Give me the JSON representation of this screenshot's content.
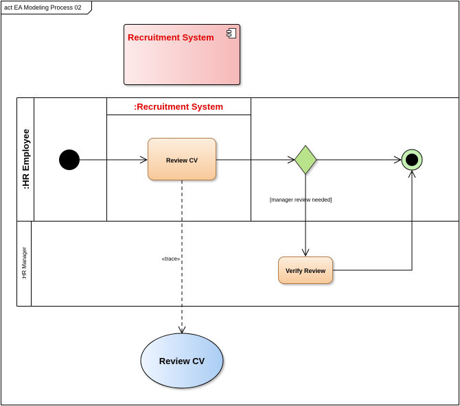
{
  "frame": {
    "title": "act EA Modeling Process 02"
  },
  "component": {
    "label": "Recruitment System",
    "icon": "component-icon"
  },
  "partition": {
    "label": ":Recruitment System"
  },
  "lanes": [
    {
      "label": ":HR Employee"
    },
    {
      "label": ":HR Manager"
    }
  ],
  "actions": {
    "review_cv": "Review CV",
    "verify_review": "Verify Review"
  },
  "guard": {
    "label": "[manager review needed]"
  },
  "trace": {
    "label": "«trace»"
  },
  "use_case": {
    "label": "Review CV"
  },
  "colors": {
    "action_fill_top": "#fdeedd",
    "action_fill_bottom": "#f8c99a",
    "action_border": "#b07a4a",
    "component_fill_left": "#fdeaea",
    "component_fill_right": "#f6b8b8",
    "component_text": "#e00000",
    "decision_fill": "#b9e38a",
    "final_ring": "#c6f0b4",
    "use_case_fill_left": "#eef5ff",
    "use_case_fill_right": "#aacdf4"
  }
}
